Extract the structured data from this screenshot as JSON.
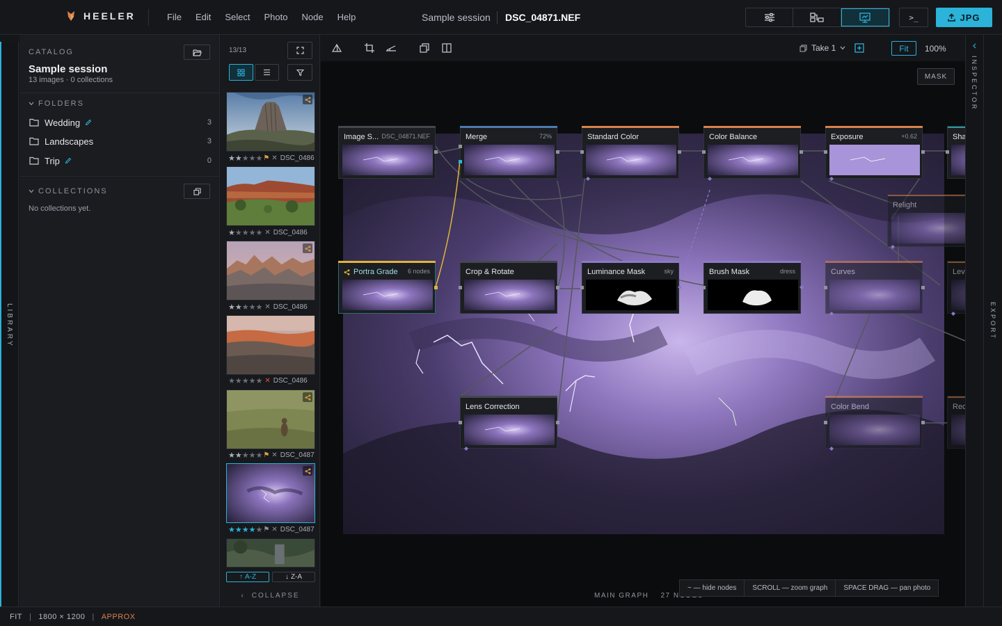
{
  "app": {
    "name": "HEELER"
  },
  "menu": [
    "File",
    "Edit",
    "Select",
    "Photo",
    "Node",
    "Help"
  ],
  "header": {
    "session": "Sample session",
    "file": "DSC_04871.NEF",
    "terminal": ">_",
    "export_label": "JPG"
  },
  "library_label": "LIBRARY",
  "inspector_label": "INSPECTOR",
  "export_label": "EXPORT",
  "catalog": {
    "heading": "CATALOG",
    "name": "Sample session",
    "summary": "13 images · 0 collections",
    "folders_heading": "FOLDERS",
    "folders": [
      {
        "name": "Wedding",
        "count": "3"
      },
      {
        "name": "Landscapes",
        "count": "3"
      },
      {
        "name": "Trip",
        "count": "0"
      }
    ],
    "collections_heading": "COLLECTIONS",
    "collections_empty": "No collections yet."
  },
  "filmstrip": {
    "count": "13/13",
    "items": [
      {
        "file": "DSC_0486",
        "rating": 2
      },
      {
        "file": "DSC_0486",
        "rating": 1
      },
      {
        "file": "DSC_0486",
        "rating": 2
      },
      {
        "file": "DSC_0486",
        "rating": 0
      },
      {
        "file": "DSC_0487",
        "rating": 2
      },
      {
        "file": "DSC_0487",
        "rating": 4
      }
    ],
    "sort_az": "A-Z",
    "sort_za": "Z-A",
    "collapse": "COLLAPSE"
  },
  "canvas": {
    "take": "Take 1",
    "fit": "Fit",
    "zoom": "100%",
    "mask": "MASK",
    "nodes": {
      "image_source": {
        "title": "Image S...",
        "extra": "DSC_04871.NEF"
      },
      "merge": {
        "title": "Merge",
        "extra": "72%"
      },
      "standard_color": {
        "title": "Standard Color"
      },
      "color_balance": {
        "title": "Color Balance"
      },
      "exposure": {
        "title": "Exposure",
        "extra": "+0.62"
      },
      "sharpen": {
        "title": "Sha"
      },
      "relight": {
        "title": "Relight"
      },
      "portra_grade": {
        "title": "Portra Grade",
        "extra": "6 nodes"
      },
      "crop_rotate": {
        "title": "Crop & Rotate"
      },
      "luminance_mask": {
        "title": "Luminance Mask",
        "extra": "sky"
      },
      "brush_mask": {
        "title": "Brush Mask",
        "extra": "dress"
      },
      "curves": {
        "title": "Curves"
      },
      "levels": {
        "title": "Leve"
      },
      "lens_correction": {
        "title": "Lens Correction"
      },
      "color_bend": {
        "title": "Color Bend"
      },
      "reduce": {
        "title": "Rec"
      }
    },
    "hints": [
      "~ — hide nodes",
      "SCROLL — zoom graph",
      "SPACE DRAG — pan photo"
    ],
    "graph_label": "MAIN GRAPH",
    "graph_count": "27 NODES"
  },
  "status": {
    "mode": "FIT",
    "size": "1800 × 1200",
    "approx": "APPROX"
  },
  "colors": {
    "accent": "#2bb3d9",
    "orange": "#d9824a",
    "yellow": "#e0b43a",
    "purple": "#8a7ac8"
  }
}
